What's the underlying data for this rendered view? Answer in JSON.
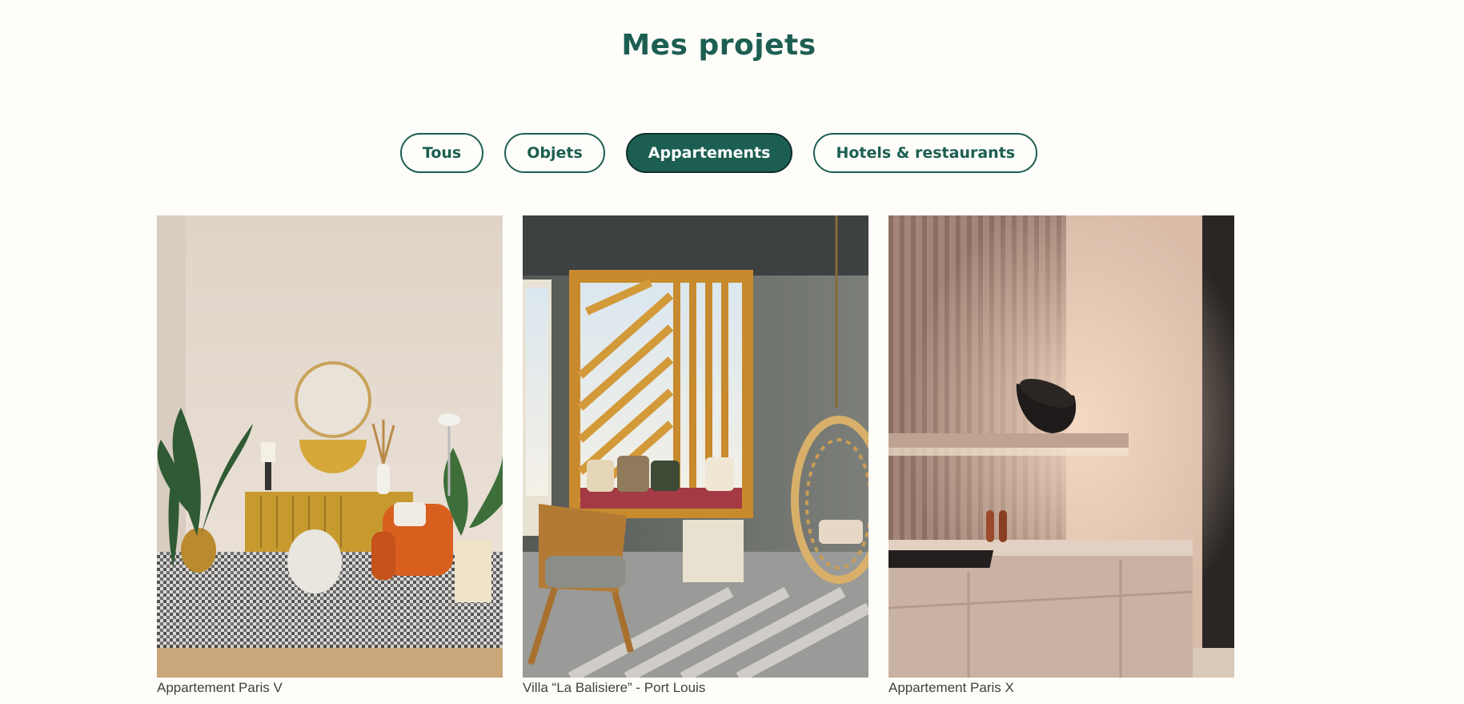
{
  "page": {
    "title": "Mes projets"
  },
  "filters": [
    {
      "label": "Tous",
      "active": false
    },
    {
      "label": "Objets",
      "active": false
    },
    {
      "label": "Appartements",
      "active": true
    },
    {
      "label": "Hotels & restaurants",
      "active": false
    }
  ],
  "projects": [
    {
      "caption": "Appartement Paris V"
    },
    {
      "caption": "Villa “La Balisiere” - Port Louis"
    },
    {
      "caption": "Appartement Paris X"
    }
  ]
}
